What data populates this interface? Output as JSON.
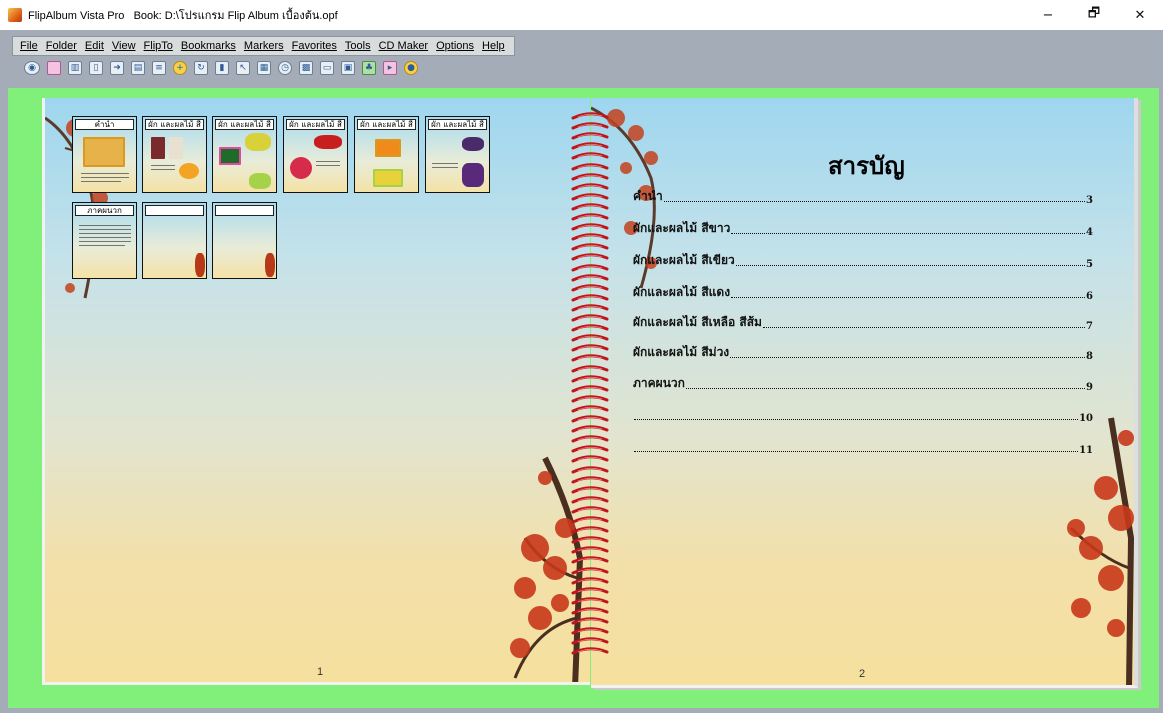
{
  "window": {
    "app_name": "FlipAlbum Vista Pro",
    "book_label": "Book: D:\\โปรแกรม Flip Album เบื้องต้น.opf",
    "minimize": "−",
    "restore": "🗗",
    "close": "✕"
  },
  "menu": [
    "File",
    "Folder",
    "Edit",
    "View",
    "FlipTo",
    "Bookmarks",
    "Markers",
    "Favorites",
    "Tools",
    "CD Maker",
    "Options",
    "Help"
  ],
  "toolbar_icons": [
    "view-icon",
    "pink-page-icon",
    "book-icon",
    "page-icon",
    "arrow-icon",
    "flip-icon",
    "page-list-icon",
    "add-icon",
    "rotate-icon",
    "columns-icon",
    "cursor-icon",
    "album-icon",
    "clock-icon",
    "grid-icon",
    "image-icon",
    "frame-icon",
    "tree-icon",
    "marker-icon",
    "star-icon"
  ],
  "colors": {
    "workspace": "#80f07a",
    "app_bg": "#a3acb7",
    "menu_bg": "#d8dcdd",
    "coil": "#c0161b"
  },
  "left_page": {
    "number": "1",
    "thumbnails": [
      {
        "label": "คำนำ"
      },
      {
        "label": "ผัก และผลไม้ สี"
      },
      {
        "label": "ผัก และผลไม้ สี"
      },
      {
        "label": "ผัก และผลไม้ สี"
      },
      {
        "label": "ผัก และผลไม้ สี"
      },
      {
        "label": "ผัก และผลไม้ สี"
      },
      {
        "label": "ภาคผนวก"
      },
      {
        "label": ""
      },
      {
        "label": ""
      }
    ]
  },
  "right_page": {
    "number": "2",
    "title": "สารบัญ",
    "toc": [
      {
        "label": "คำนำ",
        "page": "3"
      },
      {
        "label": "ผักและผลไม้ สีขาว",
        "page": "4"
      },
      {
        "label": "ผักและผลไม้ สีเขียว",
        "page": "5"
      },
      {
        "label": "ผักและผลไม้ สีแดง",
        "page": "6"
      },
      {
        "label": "ผักและผลไม้ สีเหลือ สีส้ม",
        "page": "7"
      },
      {
        "label": "ผักและผลไม้ สีม่วง",
        "page": "8"
      },
      {
        "label": "ภาคผนวก",
        "page": "9"
      },
      {
        "label": "",
        "page": "10"
      },
      {
        "label": "",
        "page": "11"
      }
    ]
  }
}
